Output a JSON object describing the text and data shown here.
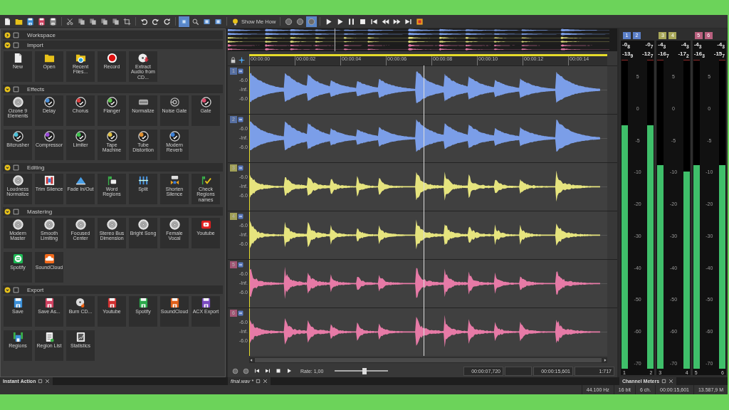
{
  "toolbar": [
    {
      "kind": "doc",
      "selected": false
    },
    {
      "kind": "folder",
      "selected": false
    },
    {
      "kind": "floppy",
      "color": "#3a8fd8",
      "selected": false
    },
    {
      "kind": "floppy",
      "color": "#d04060",
      "selected": false
    },
    {
      "kind": "floppy",
      "color": "#8a8a8a",
      "selected": false
    },
    {
      "kind": "sep"
    },
    {
      "kind": "scissors",
      "selected": false
    },
    {
      "kind": "copy",
      "selected": false
    },
    {
      "kind": "copy",
      "selected": false
    },
    {
      "kind": "copy",
      "selected": false
    },
    {
      "kind": "copy",
      "selected": false
    },
    {
      "kind": "crop",
      "selected": false
    },
    {
      "kind": "sep"
    },
    {
      "kind": "undo",
      "selected": false
    },
    {
      "kind": "redo",
      "selected": false
    },
    {
      "kind": "reset",
      "selected": false
    },
    {
      "kind": "sep"
    },
    {
      "kind": "tool",
      "selected": true
    },
    {
      "kind": "zoom",
      "selected": false
    },
    {
      "kind": "tool",
      "selected": false
    },
    {
      "kind": "tool",
      "selected": false
    },
    {
      "kind": "sep"
    },
    {
      "kind": "bulb",
      "label": "Show Me How",
      "selected": false
    },
    {
      "kind": "sep"
    },
    {
      "kind": "circle",
      "selected": false
    },
    {
      "kind": "circle",
      "selected": false
    },
    {
      "kind": "circle",
      "selected": true
    },
    {
      "kind": "sep"
    },
    {
      "kind": "play",
      "selected": false
    },
    {
      "kind": "play",
      "selected": false
    },
    {
      "kind": "pause",
      "selected": false
    },
    {
      "kind": "stop",
      "selected": false
    },
    {
      "kind": "skip-back",
      "selected": false
    },
    {
      "kind": "rewind",
      "selected": false
    },
    {
      "kind": "forward",
      "selected": false
    },
    {
      "kind": "skip-end",
      "selected": false
    },
    {
      "kind": "misc",
      "selected": false
    }
  ],
  "instant_action": {
    "tab": "Instant Action",
    "sections": [
      {
        "title": "Workspace",
        "expanded": false
      },
      {
        "title": "Import",
        "expanded": true,
        "items": [
          {
            "label": "New",
            "kind": "doc"
          },
          {
            "label": "Open",
            "kind": "folder"
          },
          {
            "label": "Recent Files...",
            "kind": "folder-recent"
          },
          {
            "label": "Record",
            "kind": "record"
          },
          {
            "label": "Extract Audio from CD...",
            "kind": "cd"
          }
        ]
      },
      {
        "title": "Effects",
        "expanded": true,
        "items": [
          {
            "label": "Ozone 9 Elements",
            "kind": "disc"
          },
          {
            "label": "Delay",
            "kind": "knob",
            "color": "#4a8fd8"
          },
          {
            "label": "Chorus",
            "kind": "knob",
            "color": "#d83a3a"
          },
          {
            "label": "Flanger",
            "kind": "knob",
            "color": "#5bc24a"
          },
          {
            "label": "Normalize",
            "kind": "normalize"
          },
          {
            "label": "Noise Gate",
            "kind": "ring"
          },
          {
            "label": "Gate",
            "kind": "knob",
            "color": "#d84a6a"
          },
          {
            "label": "Bitcrusher",
            "kind": "knob",
            "color": "#4ac0d8"
          },
          {
            "label": "Compressor",
            "kind": "knob",
            "color": "#9a4ad8"
          },
          {
            "label": "Limiter",
            "kind": "knob",
            "color": "#3ac04a"
          },
          {
            "label": "Tape Machine",
            "kind": "knob",
            "color": "#e0c040"
          },
          {
            "label": "Tube Distortion",
            "kind": "knob",
            "color": "#e09030"
          },
          {
            "label": "Modern Reverb",
            "kind": "knob",
            "color": "#3a7fd8"
          }
        ]
      },
      {
        "title": "Editing",
        "expanded": true,
        "items": [
          {
            "label": "Loudness Normalize",
            "kind": "disc"
          },
          {
            "label": "Trim Silence",
            "kind": "trim"
          },
          {
            "label": "Fade In/Out",
            "kind": "fade"
          },
          {
            "label": "Word Regions",
            "kind": "flags"
          },
          {
            "label": "Split",
            "kind": "bars"
          },
          {
            "label": "Shorten Silence",
            "kind": "shorten"
          },
          {
            "label": "Check Regions names",
            "kind": "check"
          }
        ]
      },
      {
        "title": "Mastering",
        "expanded": true,
        "items": [
          {
            "label": "Modern Master",
            "kind": "disc"
          },
          {
            "label": "Smooth Limiting",
            "kind": "disc"
          },
          {
            "label": "Focused Center",
            "kind": "disc"
          },
          {
            "label": "Stereo Bus Dimension",
            "kind": "disc"
          },
          {
            "label": "Bright Song",
            "kind": "disc"
          },
          {
            "label": "Female Vocal",
            "kind": "disc"
          },
          {
            "label": "Youtube",
            "kind": "logo-play",
            "color": "#e02020"
          },
          {
            "label": "Spotify",
            "kind": "logo-waves",
            "color": "#1db954"
          },
          {
            "label": "SoundCloud",
            "kind": "logo-cloud",
            "color": "#f26a1b"
          }
        ]
      },
      {
        "title": "Export",
        "expanded": true,
        "items": [
          {
            "label": "Save",
            "kind": "floppy",
            "color": "#3a8fd8"
          },
          {
            "label": "Save As...",
            "kind": "floppy",
            "color": "#d04060"
          },
          {
            "label": "Burn CD...",
            "kind": "burn"
          },
          {
            "label": "Youtube",
            "kind": "floppy",
            "color": "#d03030"
          },
          {
            "label": "Spotify",
            "kind": "floppy",
            "color": "#2aa84a"
          },
          {
            "label": "SoundCloud",
            "kind": "floppy",
            "color": "#e0601a"
          },
          {
            "label": "ACX Export",
            "kind": "floppy",
            "color": "#7a4ac0"
          },
          {
            "label": "Regions",
            "kind": "regions"
          },
          {
            "label": "Region List",
            "kind": "list"
          },
          {
            "label": "Statistics",
            "kind": "chart"
          }
        ]
      }
    ]
  },
  "editor": {
    "tab": "final.wav *",
    "ruler": [
      "00:00:00",
      "00:00:02",
      "00:00:04",
      "00:00:06",
      "00:00:08",
      "00:00:10",
      "00:00:12",
      "00:00:14"
    ],
    "tracks": [
      {
        "number": "1",
        "color": "#7b9ee8",
        "scale": [
          "-6.0",
          "-Inf.",
          "-6.0"
        ]
      },
      {
        "number": "2",
        "color": "#7b9ee8",
        "scale": [
          "-6.0",
          "-Inf.",
          "-6.0"
        ]
      },
      {
        "number": "3",
        "color": "#e6e47e",
        "scale": [
          "-6.0",
          "-Inf.",
          "-6.0"
        ]
      },
      {
        "number": "4",
        "color": "#e6e47e",
        "scale": [
          "-6.0",
          "-Inf.",
          "-6.0"
        ]
      },
      {
        "number": "5",
        "color": "#e67aa6",
        "scale": [
          "-6.0",
          "-Inf.",
          "-6.0"
        ]
      },
      {
        "number": "6",
        "color": "#e67aa6",
        "scale": [
          "-6.0",
          "-Inf.",
          "-6.0"
        ]
      }
    ],
    "transport": {
      "rate": "Rate: 1,00",
      "rate_slider": {
        "level": 0.56
      },
      "times": [
        "00:00:07,720",
        "00:00:15,601",
        "1:717"
      ]
    }
  },
  "meters": {
    "tab": "Channel Meters",
    "groups": [
      {
        "scale": [
          "5",
          "0",
          "-5",
          "-10",
          "-20",
          "-30",
          "-40",
          "-50",
          "-60",
          "-70"
        ],
        "channels": [
          {
            "number": "1",
            "footer": "1",
            "color": "#5b7fc7",
            "peak": "-0$_{8}$",
            "rms": "-13$_{9}$",
            "level": 0.79
          },
          {
            "number": "2",
            "footer": "2",
            "color": "#5b7fc7",
            "peak": "-0$_{7}$",
            "rms": "-12$_{7}$",
            "level": 0.79
          }
        ]
      },
      {
        "scale": [
          "5",
          "0",
          "-5",
          "-10",
          "-20",
          "-30",
          "-40",
          "-50",
          "-60",
          "-70"
        ],
        "channels": [
          {
            "number": "3",
            "footer": "3",
            "color": "#a9a85a",
            "peak": "-4$_{3}$",
            "rms": "-16$_{7}$",
            "level": 0.66
          },
          {
            "number": "4",
            "footer": "4",
            "color": "#a9a85a",
            "peak": "-4$_{3}$",
            "rms": "-17$_{2}$",
            "level": 0.64
          }
        ]
      },
      {
        "scale": [
          "5",
          "0",
          "-5",
          "-10",
          "-20",
          "-30",
          "-40",
          "-50",
          "-60",
          "-70"
        ],
        "channels": [
          {
            "number": "5",
            "footer": "5",
            "color": "#b8607e",
            "peak": "-4$_{3}$",
            "rms": "-16$_{3}$",
            "level": 0.66
          },
          {
            "number": "6",
            "footer": "6",
            "color": "#b8607e",
            "peak": "-4$_{3}$",
            "rms": "-15$_{7}$",
            "level": 0.66
          }
        ]
      }
    ]
  },
  "status_bar": [
    "44.100 Hz",
    "16 bit",
    "6 ch.",
    "00:00:15,601",
    "13.587,9 M"
  ]
}
